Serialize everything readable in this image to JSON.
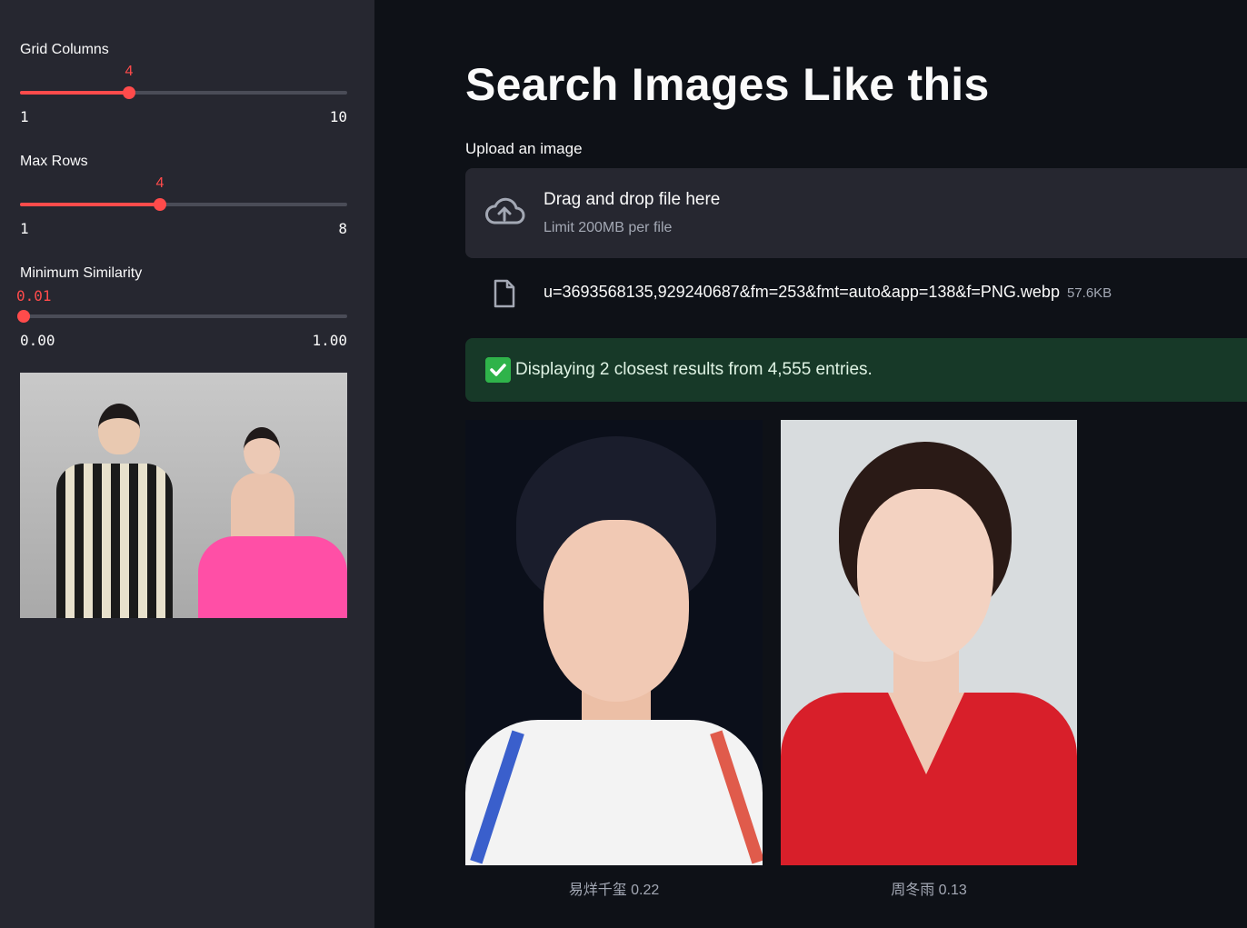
{
  "sidebar": {
    "sliders": [
      {
        "label": "Grid Columns",
        "value": "4",
        "min": "1",
        "max": "10",
        "fraction": 0.333
      },
      {
        "label": "Max Rows",
        "value": "4",
        "min": "1",
        "max": "8",
        "fraction": 0.429
      },
      {
        "label": "Minimum Similarity",
        "value": "0.01",
        "min": "0.00",
        "max": "1.00",
        "fraction": 0.01
      }
    ],
    "preview_alt": "uploaded query image"
  },
  "main": {
    "title": "Search Images Like this",
    "upload_label": "Upload an image",
    "dropzone": {
      "title": "Drag and drop file here",
      "subtitle": "Limit 200MB per file",
      "icon": "cloud-upload-icon"
    },
    "file": {
      "name": "u=3693568135,929240687&fm=253&fmt=auto&app=138&f=PNG.webp",
      "size": "57.6KB",
      "icon": "file-icon"
    },
    "status": {
      "icon": "check-icon",
      "text": "Displaying 2 closest results from 4,555 entries."
    },
    "results": [
      {
        "caption": "易烊千玺 0.22"
      },
      {
        "caption": "周冬雨 0.13"
      }
    ]
  },
  "colors": {
    "background": "#0e1117",
    "sidebar": "#262730",
    "accent": "#ff4b4b",
    "success_bg": "#173928"
  }
}
